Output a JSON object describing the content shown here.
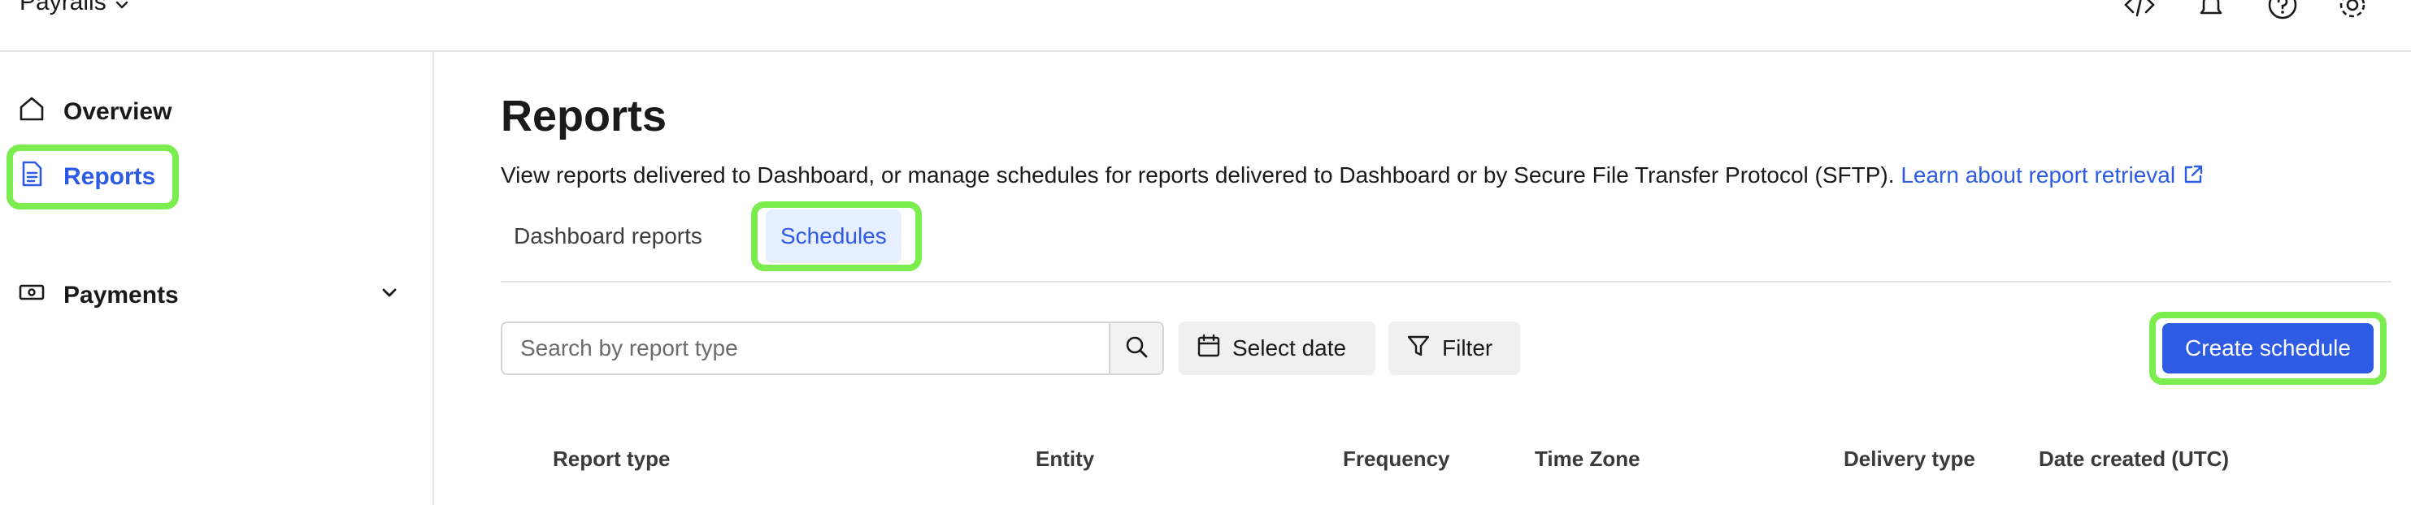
{
  "header": {
    "brand": "Payrails",
    "icons": [
      "code-icon",
      "bell-icon",
      "help-icon",
      "gear-icon"
    ]
  },
  "sidebar": {
    "items": [
      {
        "label": "Overview",
        "icon": "home-icon",
        "active": false
      },
      {
        "label": "Reports",
        "icon": "report-icon",
        "active": true
      },
      {
        "label": "Payments",
        "icon": "payments-icon",
        "active": false,
        "expandable": true
      }
    ]
  },
  "main": {
    "title": "Reports",
    "description": "View reports delivered to Dashboard, or manage schedules for reports delivered to Dashboard or by Secure File Transfer Protocol (SFTP).",
    "learn_link": "Learn about report retrieval",
    "tabs": [
      {
        "label": "Dashboard reports",
        "active": false
      },
      {
        "label": "Schedules",
        "active": true
      }
    ],
    "search": {
      "placeholder": "Search by report type",
      "value": ""
    },
    "select_date_label": "Select date",
    "filter_label": "Filter",
    "create_label": "Create schedule",
    "columns": [
      "Report type",
      "Entity",
      "Frequency",
      "Time Zone",
      "Delivery type",
      "Date created (UTC)"
    ]
  },
  "colors": {
    "accent": "#2d5be3",
    "highlight": "#7ced4e",
    "active_tab_bg": "#e6efff"
  }
}
